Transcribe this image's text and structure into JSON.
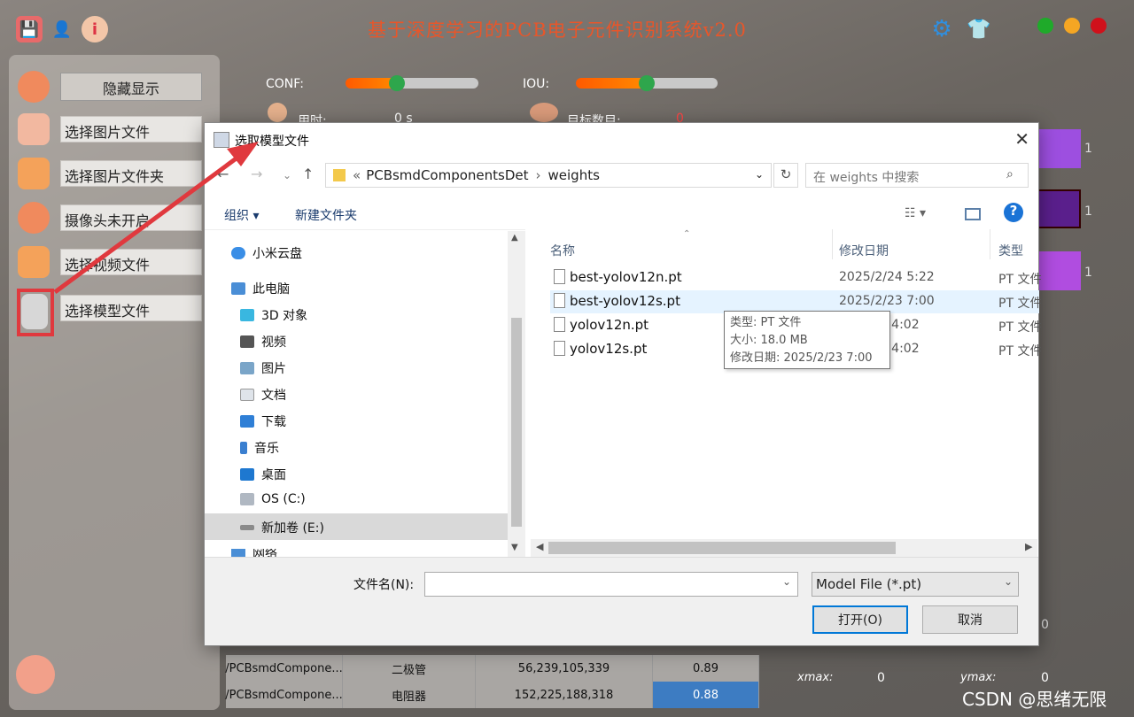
{
  "app": {
    "title": "基于深度学习的PCB电子元件识别系统v2.0"
  },
  "left": {
    "hide_label": "隐藏显示",
    "items": [
      {
        "label": "选择图片文件"
      },
      {
        "label": "选择图片文件夹"
      },
      {
        "label": "摄像头未开启"
      },
      {
        "label": "选择视频文件"
      },
      {
        "label": "选择模型文件"
      }
    ]
  },
  "main": {
    "conf_label": "CONF:",
    "iou_label": "IOU:",
    "conf_value": 0.39,
    "iou_value": 0.5,
    "time_label": "用时:",
    "time_value": "0 s",
    "count_label": "目标数目:",
    "count_value": "0",
    "right_nums": [
      "1",
      "1",
      "1"
    ],
    "bottom_num": "0",
    "xmax_label": "xmax:",
    "xmax_value": "0",
    "ymax_label": "ymax:",
    "ymax_value": "0"
  },
  "table": {
    "rows": [
      [
        "/PCBsmdCompone...",
        "二极管",
        "56,239,105,339",
        "0.89"
      ],
      [
        "/PCBsmdCompone...",
        "电阻器",
        "152,225,188,318",
        "0.88"
      ]
    ]
  },
  "dialog": {
    "title": "选取模型文件",
    "address": {
      "prefix": "«",
      "seg1": "PCBsmdComponentsDet",
      "sep": "›",
      "seg2": "weights"
    },
    "search_placeholder": "在 weights 中搜索",
    "toolbar": {
      "organize": "组织 ▾",
      "new_folder": "新建文件夹"
    },
    "nav": [
      {
        "label": "小米云盘",
        "icon": "cloud-icon"
      },
      {
        "label": "此电脑",
        "icon": "computer-icon"
      },
      {
        "label": "3D 对象",
        "icon": "cube-icon"
      },
      {
        "label": "视频",
        "icon": "video-icon"
      },
      {
        "label": "图片",
        "icon": "picture-icon"
      },
      {
        "label": "文档",
        "icon": "document-icon"
      },
      {
        "label": "下载",
        "icon": "download-icon"
      },
      {
        "label": "音乐",
        "icon": "music-icon"
      },
      {
        "label": "桌面",
        "icon": "desktop-icon"
      },
      {
        "label": "OS (C:)",
        "icon": "drive-icon"
      },
      {
        "label": "新加卷 (E:)",
        "icon": "drive-icon"
      },
      {
        "label": "网络",
        "icon": "network-icon"
      }
    ],
    "columns": {
      "name": "名称",
      "date": "修改日期",
      "type": "类型"
    },
    "files": [
      {
        "name": "best-yolov12n.pt",
        "date": "2025/2/24 5:22",
        "type": "PT 文件"
      },
      {
        "name": "best-yolov12s.pt",
        "date": "2025/2/23 7:00",
        "type": "PT 文件"
      },
      {
        "name": "yolov12n.pt",
        "date": "20 14:02",
        "type": "PT 文件"
      },
      {
        "name": "yolov12s.pt",
        "date": "20 14:02",
        "type": "PT 文件"
      }
    ],
    "tooltip": {
      "type": "类型: PT 文件",
      "size": "大小: 18.0 MB",
      "date": "修改日期: 2025/2/23 7:00"
    },
    "filename_label": "文件名(N):",
    "filename_value": "",
    "filetype": "Model File (*.pt)",
    "open_label": "打开(O)",
    "cancel_label": "取消"
  },
  "watermark": "CSDN @思绪无限"
}
